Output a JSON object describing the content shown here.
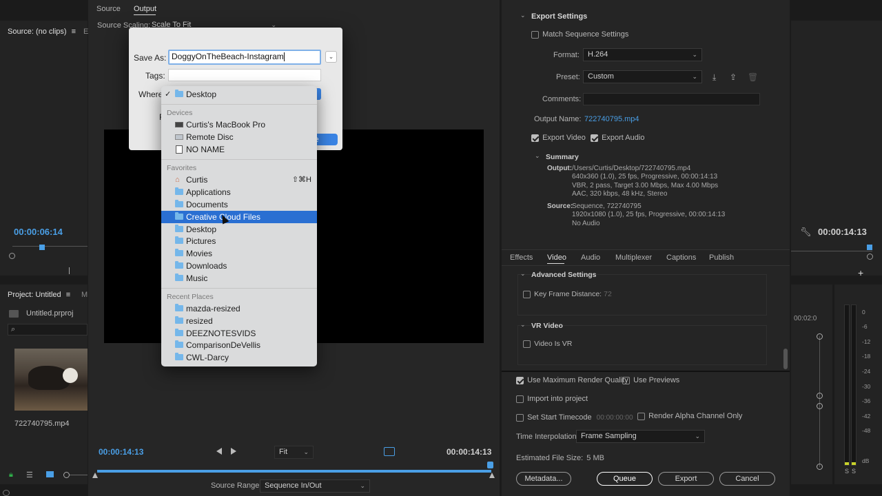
{
  "source_monitor": {
    "tabs": [
      "Source",
      "Output"
    ],
    "source_scaling_label": "Source Scaling:",
    "source_scaling_value": "Scale To Fit",
    "timecode_left": "00:00:14:13",
    "timecode_right": "00:00:14:13",
    "fit_value": "Fit",
    "source_range_label": "Source Range:",
    "source_range_value": "Sequence In/Out"
  },
  "left_panel": {
    "source_tab": "Source: (no clips)",
    "source_tab2": "E",
    "timecode": "00:00:06:14",
    "project_tab": "Project: Untitled",
    "project_tab2": "M",
    "project_file": "Untitled.prproj",
    "clip_name": "722740795.mp4"
  },
  "save_dialog": {
    "save_as_label": "Save As:",
    "save_as_value": "DoggyOnTheBeach-Instagram",
    "tags_label": "Tags:",
    "where_label": "Where",
    "hidden_letter": "F",
    "save_button_fragment": "re"
  },
  "where_menu": {
    "current": "Desktop",
    "devices_header": "Devices",
    "devices": [
      "Curtis's MacBook Pro",
      "Remote Disc",
      "NO NAME"
    ],
    "favorites_header": "Favorites",
    "favorites": [
      "Curtis",
      "Applications",
      "Documents",
      "Creative Cloud Files",
      "Desktop",
      "Pictures",
      "Movies",
      "Downloads",
      "Music"
    ],
    "home_shortcut": "⇧⌘H",
    "recent_header": "Recent Places",
    "recent": [
      "mazda-resized",
      "resized",
      "DEEZNOTESVIDS",
      "ComparisonDeVellis",
      "CWL-Darcy"
    ]
  },
  "export_settings": {
    "header": "Export Settings",
    "match_sequence": "Match Sequence Settings",
    "format_label": "Format:",
    "format_value": "H.264",
    "preset_label": "Preset:",
    "preset_value": "Custom",
    "comments_label": "Comments:",
    "output_name_label": "Output Name:",
    "output_name_value": "722740795.mp4",
    "export_video": "Export Video",
    "export_audio": "Export Audio",
    "summary_header": "Summary",
    "output_label": "Output:",
    "output_lines": [
      "/Users/Curtis/Desktop/722740795.mp4",
      "640x360 (1.0), 25 fps, Progressive, 00:00:14:13",
      "VBR, 2 pass, Target 3.00 Mbps, Max 4.00 Mbps",
      "AAC, 320 kbps, 48 kHz, Stereo"
    ],
    "source_label": "Source:",
    "source_lines": [
      "Sequence, 722740795",
      "1920x1080 (1.0), 25 fps, Progressive, 00:00:14:13",
      "No Audio"
    ],
    "tabs": [
      "Effects",
      "Video",
      "Audio",
      "Multiplexer",
      "Captions",
      "Publish"
    ],
    "advanced_header": "Advanced Settings",
    "key_frame_label": "Key Frame Distance:",
    "key_frame_value": "72",
    "vr_header": "VR Video",
    "video_is_vr": "Video Is VR",
    "use_max_render": "Use Maximum Render Quality",
    "use_previews": "Use Previews",
    "import_into_project": "Import into project",
    "set_start_timecode": "Set Start Timecode",
    "start_timecode_value": "00:00:00:00",
    "render_alpha": "Render Alpha Channel Only",
    "time_interp_label": "Time Interpolation:",
    "time_interp_value": "Frame Sampling",
    "est_file_size_label": "Estimated File Size:",
    "est_file_size_value": "5 MB",
    "buttons": {
      "metadata": "Metadata...",
      "queue": "Queue",
      "export": "Export",
      "cancel": "Cancel"
    }
  },
  "right_edge": {
    "timecode": "00:00:14:13",
    "ruler_label": "00:02:0",
    "meter_ticks": [
      "0",
      "-6",
      "-12",
      "-18",
      "-24",
      "-30",
      "-36",
      "-42",
      "-48",
      "dB"
    ],
    "solo": [
      "S",
      "S"
    ]
  }
}
